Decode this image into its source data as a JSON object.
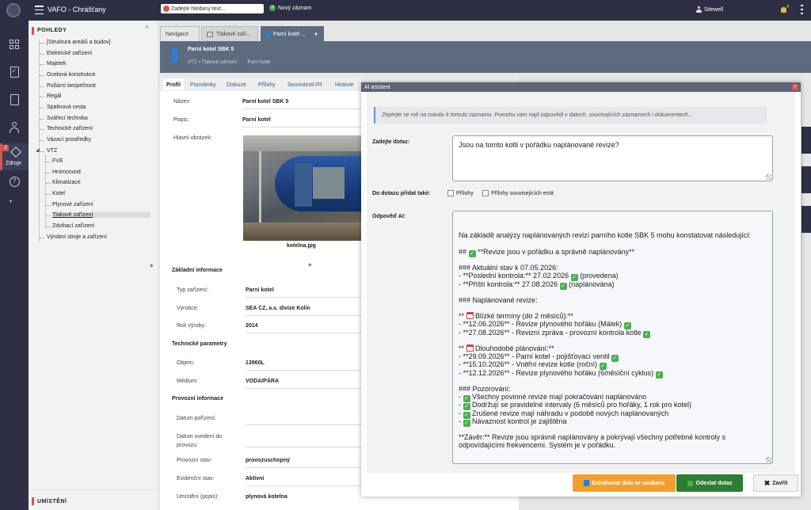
{
  "topbar": {
    "app_title": "VAFO - Chrášťany",
    "search_placeholder": "Zadejte hledaný text...",
    "new_record": "Nový záznam",
    "user": "Sitewell",
    "notif_count": "4"
  },
  "rail": {
    "badge": "2",
    "resources_label": "Zdroje"
  },
  "tree": {
    "header": "POHLEDY",
    "footer": "UMÍSTĚNÍ",
    "items": [
      "[Struktura areálů a budov]",
      "Elektrické zařízení",
      "Majetek",
      "Ocelová konstrukce",
      "Požární bezpečnost",
      "Regál",
      "Spalinová cesta",
      "Svářecí technika",
      "Technické zařízení",
      "Vázací prostředky",
      "VTZ",
      "FVE",
      "Hromosvod",
      "Klimatizace",
      "Kotel",
      "Plynové zařízení",
      "Tlakové zařízení",
      "Zdvihací zařízení",
      "Výrobní stroje a zařízení"
    ]
  },
  "tabs": {
    "nav": "Navigace",
    "tab2": "Tlakové zaří...",
    "tab3": "Parní kotel ..."
  },
  "record": {
    "title": "Parní kotel SBK 5",
    "breadcrumb_path": "VTZ > Tlakové zařízení",
    "breadcrumb_current": "Parní kotel"
  },
  "subtabs": {
    "profil": "Profil",
    "poznamky": "Poznámky",
    "diskuze": "Diskuze",
    "prilohy": "Přílohy",
    "souvislosti": "Souvislosti",
    "souvislosti_count": "(20)",
    "historie": "Historie"
  },
  "profile": {
    "nazev_label": "Název:",
    "nazev_value": "Parní kotel SBK 5",
    "popis_label": "Popis:",
    "popis_value": "Parní kotel",
    "image_label": "Hlavní obrázek:",
    "image_caption": "kotelna.jpg",
    "sec_basic": "Základní informace",
    "typ_label": "Typ zařízení:",
    "typ_value": "Parní kotel",
    "vyrobce_label": "Výrobce:",
    "vyrobce_value": "SEA CZ, a.s. divize Kolín",
    "rok_label": "Rok výroby:",
    "rok_value": "2014",
    "sec_tech": "Technické parametry",
    "objem_label": "Objem:",
    "objem_value": "13960L",
    "medium_label": "Médium:",
    "medium_value": "VODA/PÁRA",
    "sec_prov": "Provozní informace",
    "datum_por_label": "Datum pořízení:",
    "datum_uved_label": "Datum uvedení do provozu:",
    "prov_stav_label": "Provozní stav:",
    "prov_stav_value": "provozuschopný",
    "evid_stav_label": "Evidenční stav:",
    "evid_stav_value": "Aktivní",
    "umisteni_label": "Umístění (popis):",
    "umisteni_value": "plynová kotelna"
  },
  "modal": {
    "title": "AI asistent",
    "hint": "Zeptejte se mě na cokoliv k tomuto záznamu. Pomohu vám najít odpovědi v datech, souvisejících záznamech i dokumentech...",
    "query_label": "Zadejte dotaz:",
    "query_value": "Jsou na tomto kotli v pořádku naplánované revize?",
    "attach_label": "Do dotazu přidat také:",
    "attach_opt1": "Přílohy",
    "attach_opt2": "Přílohy souvisejících entit",
    "answer_label": "Odpověď AI:",
    "btn_extract": "Extrahovat data ze souboru",
    "btn_send": "Odeslat dotaz",
    "btn_close": "Zavřít"
  },
  "answer_lines": [
    {
      "t": "Na základě analýzy naplánovaných revizí parního kotle SBK 5 mohu konstatovat následující:"
    },
    {
      "t": ""
    },
    {
      "t": "## ",
      "i": "chk",
      "s": " **Revize jsou v pořádku a správně naplánovány**"
    },
    {
      "t": ""
    },
    {
      "t": "### Aktuální stav k 07.05.2026:"
    },
    {
      "t": "- **Poslední kontrola:** 27.02.2026 ",
      "i": "chk",
      "s": " (provedena)"
    },
    {
      "t": "- **Příští kontrola:** 27.08.2026 ",
      "i": "chk",
      "s": " (naplánována)"
    },
    {
      "t": ""
    },
    {
      "t": "### Naplánované revize:"
    },
    {
      "t": ""
    },
    {
      "t": "** ",
      "i": "cal",
      "s": " Blízké termíny (do 2 měsíců):**"
    },
    {
      "t": "- **12.06.2026** - Revize plynového hořáku (Málek) ",
      "i": "chk",
      "s": ""
    },
    {
      "t": "- **27.08.2026** - Revizní zpráva - provozní kontrola kotle ",
      "i": "chk",
      "s": ""
    },
    {
      "t": ""
    },
    {
      "t": "** ",
      "i": "cal",
      "s": " Dlouhodobé plánování:**"
    },
    {
      "t": "- **29.09.2026** - Parní kotel - pojišťovací ventil ",
      "i": "chk",
      "s": ""
    },
    {
      "t": "- **15.10.2026** - Vnitřní revize kotle (roční) ",
      "i": "chk",
      "s": ""
    },
    {
      "t": "- **12.12.2026** - Revize plynového hořáku (6měsíční cyklus) ",
      "i": "chk",
      "s": ""
    },
    {
      "t": ""
    },
    {
      "t": "### Pozorování:"
    },
    {
      "t": "- ",
      "i": "chk",
      "s": " Všechny povinné revize mají pokračování naplánováno"
    },
    {
      "t": "- ",
      "i": "chk",
      "s": " Dodržují se pravidelné intervaly (6 měsíců pro hořáky, 1 rok pro kotel)"
    },
    {
      "t": "- ",
      "i": "chk",
      "s": " Zrušené revize mají náhradu v podobě nových naplánovaných"
    },
    {
      "t": "- ",
      "i": "chk",
      "s": " Návaznost kontrol je zajištěna"
    },
    {
      "t": ""
    },
    {
      "t": "**Závěr:** Revize jsou správně naplánovány a pokrývají všechny potřebné kontroly s"
    },
    {
      "t": "odpovídajícími frekvencemi. Systém je v pořádku."
    }
  ],
  "colors": {
    "sidebar_bg": "#2e2f45",
    "accent_red": "#d9534f",
    "btn_orange": "#f0a030",
    "btn_green": "#2f7d32",
    "check_green": "#4caf50"
  }
}
